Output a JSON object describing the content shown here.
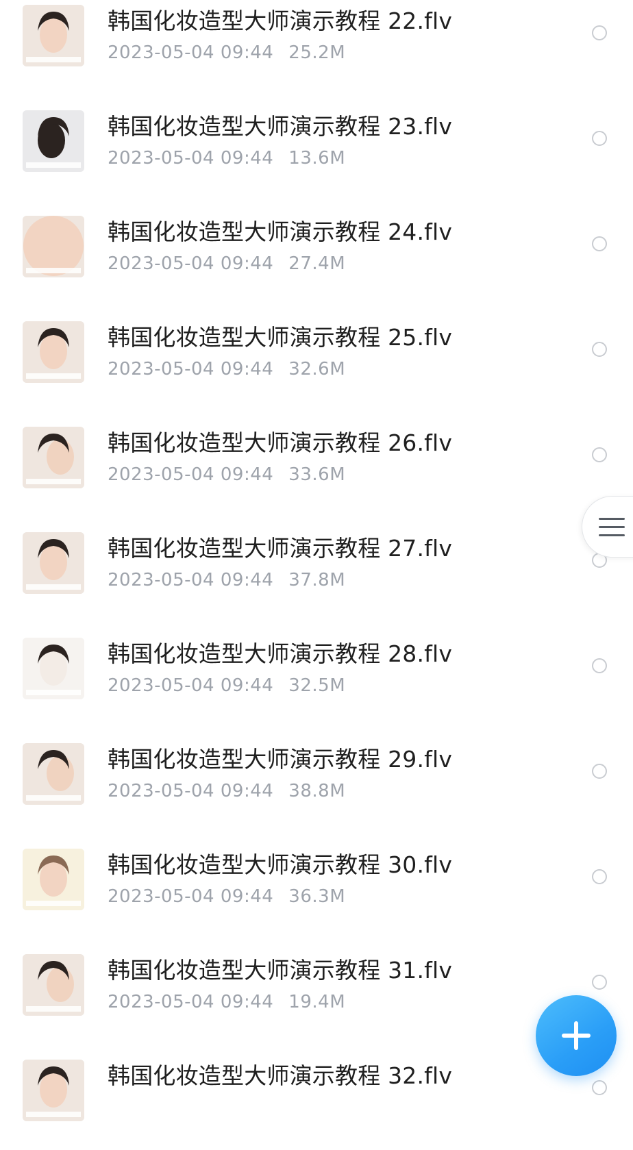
{
  "files": [
    {
      "name": "韩国化妆造型大师演示教程 22.flv",
      "date": "2023-05-04 09:44",
      "size": "25.2M",
      "thumb_icon": "face-brush-thumbnail"
    },
    {
      "name": "韩国化妆造型大师演示教程 23.flv",
      "date": "2023-05-04 09:44",
      "size": "13.6M",
      "thumb_icon": "hair-back-thumbnail"
    },
    {
      "name": "韩国化妆造型大师演示教程 24.flv",
      "date": "2023-05-04 09:44",
      "size": "27.4M",
      "thumb_icon": "closed-eyes-thumbnail"
    },
    {
      "name": "韩国化妆造型大师演示教程 25.flv",
      "date": "2023-05-04 09:44",
      "size": "32.6M",
      "thumb_icon": "face-brush-thumbnail"
    },
    {
      "name": "韩国化妆造型大师演示教程 26.flv",
      "date": "2023-05-04 09:44",
      "size": "33.6M",
      "thumb_icon": "face-hand-thumbnail"
    },
    {
      "name": "韩国化妆造型大师演示教程 27.flv",
      "date": "2023-05-04 09:44",
      "size": "37.8M",
      "thumb_icon": "face-brush-thumbnail"
    },
    {
      "name": "韩国化妆造型大师演示教程 28.flv",
      "date": "2023-05-04 09:44",
      "size": "32.5M",
      "thumb_icon": "face-mask-thumbnail"
    },
    {
      "name": "韩国化妆造型大师演示教程 29.flv",
      "date": "2023-05-04 09:44",
      "size": "38.8M",
      "thumb_icon": "face-hand-thumbnail"
    },
    {
      "name": "韩国化妆造型大师演示教程 30.flv",
      "date": "2023-05-04 09:44",
      "size": "36.3M",
      "thumb_icon": "face-front-thumbnail"
    },
    {
      "name": "韩国化妆造型大师演示教程 31.flv",
      "date": "2023-05-04 09:44",
      "size": "19.4M",
      "thumb_icon": "face-hand-thumbnail"
    },
    {
      "name": "韩国化妆造型大师演示教程 32.flv",
      "date": "",
      "size": "",
      "thumb_icon": "face-brush-thumbnail"
    }
  ],
  "side_handle": {
    "icon": "menu-icon"
  },
  "fab": {
    "icon": "plus-icon",
    "color": "#2a9ef7"
  },
  "colors": {
    "title_text": "#1f1f1f",
    "meta_text": "#9ea3ab",
    "circle_border": "#c9ccd1"
  }
}
